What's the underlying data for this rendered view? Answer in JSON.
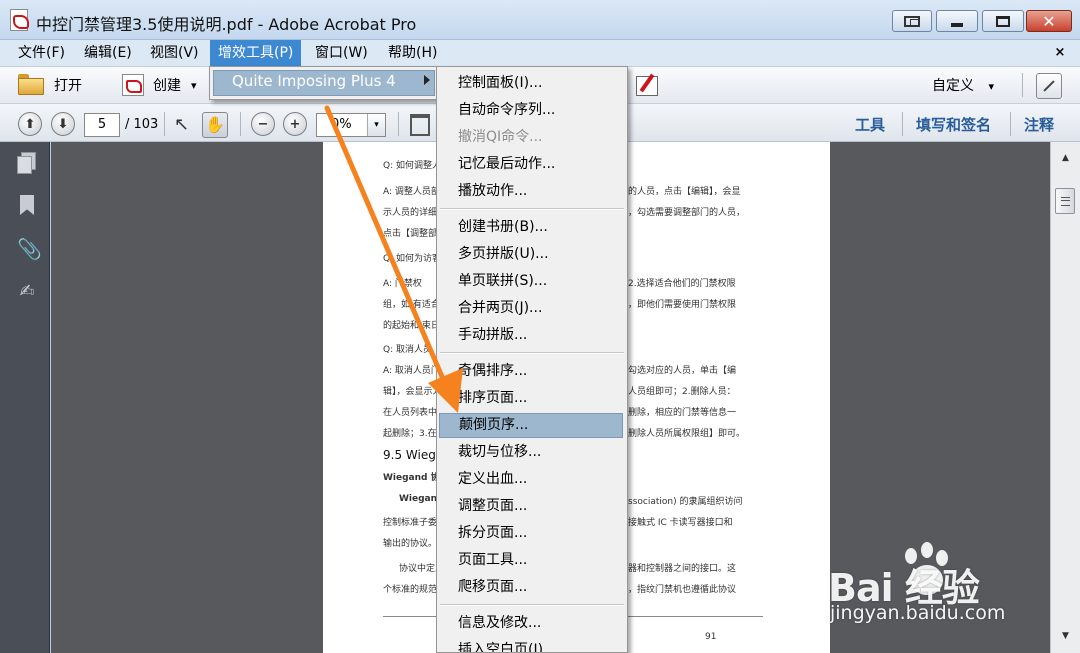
{
  "window": {
    "title": "中控门禁管理3.5使用说明.pdf - Adobe Acrobat Pro",
    "close_glyph": "✕"
  },
  "menubar": {
    "items": [
      "文件(F)",
      "编辑(E)",
      "视图(V)",
      "增效工具(P)",
      "窗口(W)",
      "帮助(H)"
    ],
    "active_index": 3,
    "close_glyph": "×"
  },
  "toolbar1": {
    "open_label": "打开",
    "create_label": "创建",
    "create_arrow": "▾",
    "custom_label": "自定义",
    "custom_arrow": "▾"
  },
  "toolbar2": {
    "page_current": "5",
    "page_total": "/ 103",
    "zoom_value": "0%",
    "zoom_arrow": "▾",
    "prev_glyph": "⬆",
    "next_glyph": "⬇",
    "zoom_out_glyph": "−",
    "zoom_in_glyph": "+",
    "select_glyph": "↖",
    "hand_glyph": "✋",
    "links": [
      "工具",
      "填写和签名",
      "注释"
    ]
  },
  "left_nav": {
    "icons": [
      "pages-icon",
      "bookmark-icon",
      "attachment-icon",
      "signature-icon"
    ],
    "clip_glyph": "📎",
    "sign_glyph": "✍"
  },
  "document": {
    "left_lines": [
      "Q: 如何调整人",
      "A: 调整人员部门",
      "示人员的详细信",
      "点击【调整部门",
      "Q: 如何为访客",
      "A: 门禁权",
      "组，如      有适合",
      "的起始和    束日",
      "Q: 取消人员",
      "A: 取消人员门",
      "辑】，会显示人",
      "在人员列表中，",
      "起删除；3.在【"
    ],
    "right_lines": [
      "的人员，点击【编辑】，会显",
      "，勾选需要调整部门的人员，",
      "2.选择适合他们的门禁权限",
      "，即他们需要使用门禁权限",
      "勾选对应的人员，单击【编",
      "人员组即可；2.删除人员：",
      "删除，相应的门禁等信息一",
      "删除人员所属权限组】即可。"
    ],
    "heading": "9.5 Wiegand",
    "lines_b_left": [
      "Wiegand 协议：",
      "Wiegand26",
      "控制标准子委员",
      "输出的协议。",
      "协议中定义",
      "个标准的规范使"
    ],
    "lines_b_right": [
      "ssociation) 的隶属组织访问",
      "接触式 IC 卡读写器接口和",
      "器和控制器之间的接口。这",
      "，指纹门禁机也遵循此协议"
    ],
    "page_number": "91"
  },
  "submenu_plugin": {
    "label": "Quite Imposing Plus 4"
  },
  "submenu_items": {
    "group1": [
      "控制面板(I)...",
      "自动命令序列...",
      "撤消QI命令...",
      "记忆最后动作...",
      "播放动作..."
    ],
    "group1_disabled_index": 2,
    "group2": [
      "创建书册(B)...",
      "多页拼版(U)...",
      "单页联拼(S)...",
      "合并两页(J)...",
      "手动拼版..."
    ],
    "group3": [
      "奇偶排序...",
      "排序页面...",
      "颠倒页序...",
      "裁切与位移...",
      "定义出血...",
      "调整页面...",
      "拆分页面...",
      "页面工具...",
      "爬移页面..."
    ],
    "group3_highlight_index": 2,
    "group4": [
      "信息及修改...",
      "插入空白页(I)..."
    ]
  },
  "annotation": {
    "color": "#f5821f"
  },
  "watermark": {
    "logo": "Bai  经验",
    "url": "jingyan.baidu.com"
  }
}
